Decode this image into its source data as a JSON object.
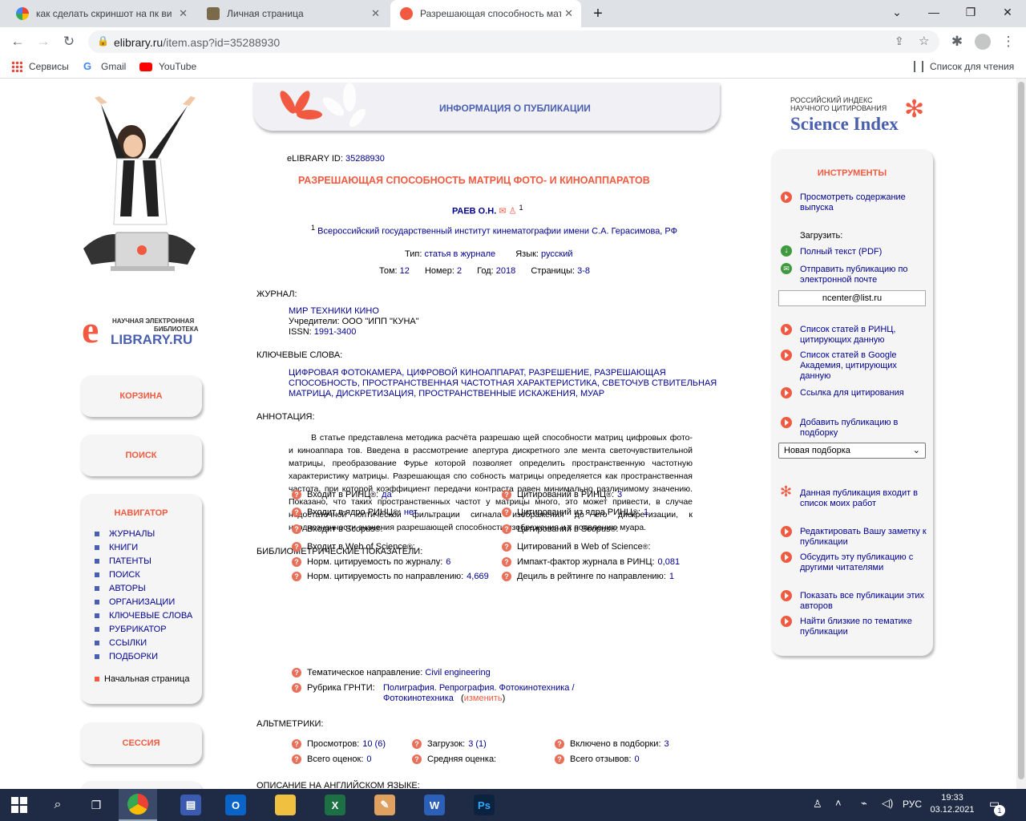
{
  "browser": {
    "tabs": [
      {
        "title": "как сделать скриншот на пк вин",
        "favicon": "google-icon"
      },
      {
        "title": "Личная страница",
        "favicon": "elibrary-icon"
      },
      {
        "title": "Разрешающая способность мат",
        "favicon": "elibrary-e-icon"
      }
    ],
    "url_host": "elibrary.ru",
    "url_path": "/item.asp?id=35288930",
    "bookmarks": [
      "Сервисы",
      "Gmail",
      "YouTube"
    ],
    "reading_list": "Список для чтения"
  },
  "left": {
    "logo_line1": "НАУЧНАЯ ЭЛЕКТРОННАЯ",
    "logo_line2": "БИБЛИОТЕКА",
    "logo_brand": "LIBRARY.RU",
    "cart": "КОРЗИНА",
    "search": "ПОИСК",
    "nav_title": "НАВИГАТОР",
    "nav_items": [
      "ЖУРНАЛЫ",
      "КНИГИ",
      "ПАТЕНТЫ",
      "ПОИСК",
      "АВТОРЫ",
      "ОРГАНИЗАЦИИ",
      "КЛЮЧЕВЫЕ СЛОВА",
      "РУБРИКАТОР",
      "ССЫЛКИ",
      "ПОДБОРКИ"
    ],
    "home": "Начальная страница",
    "session": "СЕССИЯ"
  },
  "pub": {
    "header": "ИНФОРМАЦИЯ О ПУБЛИКАЦИИ",
    "id_label": "eLIBRARY ID:",
    "id_value": "35288930",
    "title": "РАЗРЕШАЮЩАЯ СПОСОБНОСТЬ МАТРИЦ ФОТО- И КИНОАППАРАТОВ",
    "author": "РАЕВ О.Н.",
    "author_sup": "1",
    "affil_sup": "1",
    "affiliation": "Всероссийский государственный институт кинематографии имени С.А. Герасимова, РФ",
    "type_label": "Тип:",
    "type_value": "статья в журнале",
    "lang_label": "Язык:",
    "lang_value": "русский",
    "vol_label": "Том:",
    "vol_value": "12",
    "num_label": "Номер:",
    "num_value": "2",
    "year_label": "Год:",
    "year_value": "2018",
    "pages_label": "Страницы:",
    "pages_value": "3-8",
    "journal_head": "ЖУРНАЛ:",
    "journal_name": "МИР ТЕХНИКИ КИНО",
    "founders": "Учредители: ООО \"ИПП \"КУНА\"",
    "issn_label": "ISSN:",
    "issn_value": "1991-3400",
    "kw_head": "КЛЮЧЕВЫЕ СЛОВА:",
    "kw_line1": "ЦИФРОВАЯ ФОТОКАМЕРА, ЦИФРОВОЙ КИНОАППАРАТ, РАЗРЕШЕНИЕ, РАЗРЕШАЮЩАЯ",
    "kw_line2": "СПОСОБНОСТЬ, ПРОСТРАНСТВЕННАЯ ЧАСТОТНАЯ ХАРАКТЕРИСТИКА, СВЕТОЧУВ СТВИТЕЛЬНАЯ",
    "kw_line3": "МАТРИЦА, ДИСКРЕТИЗАЦИЯ, ПРОСТРАНСТВЕННЫЕ ИСКАЖЕНИЯ, МУАР",
    "abs_head": "АННОТАЦИЯ:",
    "abstract": [
      "В статье представлена методика расчёта разрешаю щей способности матриц цифровых фото-",
      "и киноаппара тов. Введена в рассмотрение апертура дискретного эле мента светочувствительной",
      "матрицы, преобразование Фурье которой позволяет определить пространственную частотную",
      "характеристику матрицы. Разрешающая спо собность матрицы определяется как пространственная",
      "частота, при которой коэффициент передачи контраста равен минимально различимому значению.",
      "Показано, что таких пространственных частот у матрицы много, это может привести, в случае",
      "недостаточной оптической фильтрации сигнала изображения до его дискретизации, к",
      "неоднозначности значения разрешающей способности изображения и к появлению муара."
    ],
    "biblio_head": "БИБЛИОМЕТРИЧЕСКИЕ ПОКАЗАТЕЛИ:",
    "biblio_left": [
      {
        "label": "Входит в РИНЦ",
        "sup": "®",
        "suffix": ":",
        "value": "да"
      },
      {
        "label": "Входит в ядро РИНЦ",
        "sup": "®",
        "suffix": ":",
        "value": "нет"
      },
      {
        "label": "Входит в Scopus",
        "sup": "®",
        "suffix": ":",
        "value": ""
      },
      {
        "label": "Входит в Web of Science",
        "sup": "®",
        "suffix": ":",
        "value": ""
      },
      {
        "label": "Норм. цитируемость по журналу:",
        "sup": "",
        "suffix": "",
        "value": "6"
      },
      {
        "label": "Норм. цитируемость по направлению:",
        "sup": "",
        "suffix": "",
        "value": "4,669"
      }
    ],
    "biblio_right": [
      {
        "label": "Цитирований в РИНЦ",
        "sup": "®",
        "suffix": ":",
        "value": "3"
      },
      {
        "label": "Цитирований из ядра РИНЦ",
        "sup": "®",
        "suffix": ":",
        "value": "1"
      },
      {
        "label": "Цитирований в Scopus",
        "sup": "®",
        "suffix": ":",
        "value": ""
      },
      {
        "label": "Цитирований в Web of Science",
        "sup": "®",
        "suffix": ":",
        "value": ""
      },
      {
        "label": "Импакт-фактор журнала в РИНЦ:",
        "sup": "",
        "suffix": "",
        "value": "0,081"
      },
      {
        "label": "Дециль в рейтинге по направлению:",
        "sup": "",
        "suffix": "",
        "value": "1"
      }
    ],
    "topic_label": "Тематическое направление:",
    "topic_value": "Civil engineering",
    "grnti_label": "Рубрика ГРНТИ:",
    "grnti_line1": "Полиграфия. Репрография. Фотокинотехника /",
    "grnti_line2": "Фотокинотехника",
    "grnti_change": "изменить",
    "alt_head": "АЛЬТМЕТРИКИ:",
    "alt": [
      {
        "label": "Просмотров:",
        "value": "10 (6)"
      },
      {
        "label": "Загрузок:",
        "value": "3 (1)"
      },
      {
        "label": "Включено в подборки:",
        "value": "3"
      },
      {
        "label": "Всего оценок:",
        "value": "0"
      },
      {
        "label": "Средняя оценка:",
        "value": ""
      },
      {
        "label": "Всего отзывов:",
        "value": "0"
      }
    ],
    "eng_head": "ОПИСАНИЕ НА АНГЛИЙСКОМ ЯЗЫКЕ:"
  },
  "right": {
    "si_line1": "РОССИЙСКИЙ ИНДЕКС",
    "si_line2": "НАУЧНОГО ЦИТИРОВАНИЯ",
    "si_brand": "Science Index",
    "tools_title": "ИНСТРУМЕНТЫ",
    "view_issue": "Просмотреть содержание выпуска",
    "download_label": "Загрузить:",
    "full_text": "Полный текст (PDF)",
    "send_email": "Отправить публикацию по электронной почте",
    "email_value": "ncenter@list.ru",
    "citing_rinc": "Список статей в РИНЦ, цитирующих данную",
    "citing_google": "Список статей в Google Академия, цитирующих данную",
    "cite_link": "Ссылка для цитирования",
    "add_collection": "Добавить публикацию в подборку",
    "collection_select": "Новая подборка",
    "in_my_works": "Данная публикация входит в список моих работ",
    "edit_note": "Редактировать Вашу заметку к публикации",
    "discuss": "Обсудить эту публикацию с другими читателями",
    "all_by_authors": "Показать все публикации этих авторов",
    "similar": "Найти близкие по тематике публикации"
  },
  "taskbar": {
    "lang": "РУС",
    "time": "19:33",
    "date": "03.12.2021",
    "notif_count": "1"
  },
  "colors": {
    "accent": "#f15a40",
    "link": "#00008f",
    "header_blue": "#4a5fb0"
  }
}
